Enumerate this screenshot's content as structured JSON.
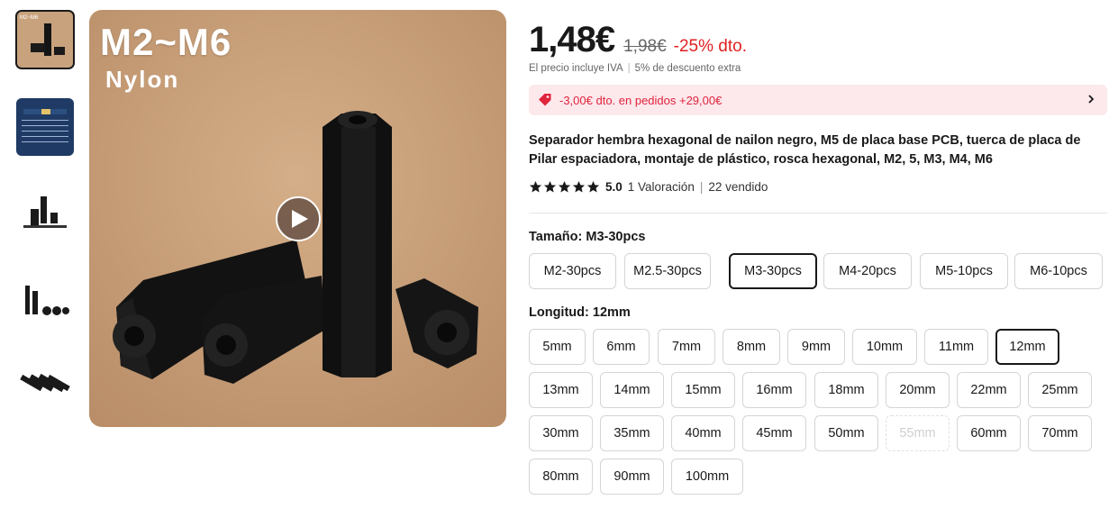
{
  "gallery": {
    "thumbnails": [
      {
        "icon": "spacers-black-thumbnail",
        "selected": true
      },
      {
        "icon": "size-chart-thumbnail",
        "selected": false
      },
      {
        "icon": "spacers-group-thumbnail",
        "selected": false
      },
      {
        "icon": "spacers-row-thumbnail",
        "selected": false
      },
      {
        "icon": "spacers-lying-thumbnail",
        "selected": false
      }
    ],
    "main_image": {
      "title": "M2~M6",
      "subtitle": "Nylon",
      "play_icon": "play-icon"
    }
  },
  "product": {
    "price": "1,48€",
    "old_price": "1,98€",
    "discount": "-25% dto.",
    "tax_note": "El precio incluye IVA",
    "extra_discount": "5% de descuento extra",
    "coupon": "-3,00€ dto. en pedidos +29,00€",
    "title": "Separador hembra hexagonal de nailon negro, M5 de placa base PCB, tuerca de placa de Pilar espaciadora, montaje de plástico, rosca hexagonal, M2, 5, M3, M4, M6",
    "rating": "5.0",
    "reviews": "1 Valoración",
    "sold": "22 vendido",
    "star_count": 5
  },
  "size": {
    "label": "Tamaño:",
    "selected": "M3-30pcs",
    "options": [
      "M2-30pcs",
      "M2.5-30pcs",
      "M3-30pcs",
      "M4-20pcs",
      "M5-10pcs",
      "M6-10pcs"
    ]
  },
  "length": {
    "label": "Longitud:",
    "selected": "12mm",
    "options": [
      "5mm",
      "6mm",
      "7mm",
      "8mm",
      "9mm",
      "10mm",
      "11mm",
      "12mm",
      "13mm",
      "14mm",
      "15mm",
      "16mm",
      "18mm",
      "20mm",
      "22mm",
      "25mm",
      "30mm",
      "35mm",
      "40mm",
      "45mm",
      "50mm",
      "55mm",
      "60mm",
      "70mm",
      "80mm",
      "90mm",
      "100mm"
    ],
    "disabled": [
      "55mm"
    ]
  },
  "colors": {
    "accent_red": "#e02020",
    "coupon_bg": "#fde8ec",
    "star": "#191919"
  }
}
